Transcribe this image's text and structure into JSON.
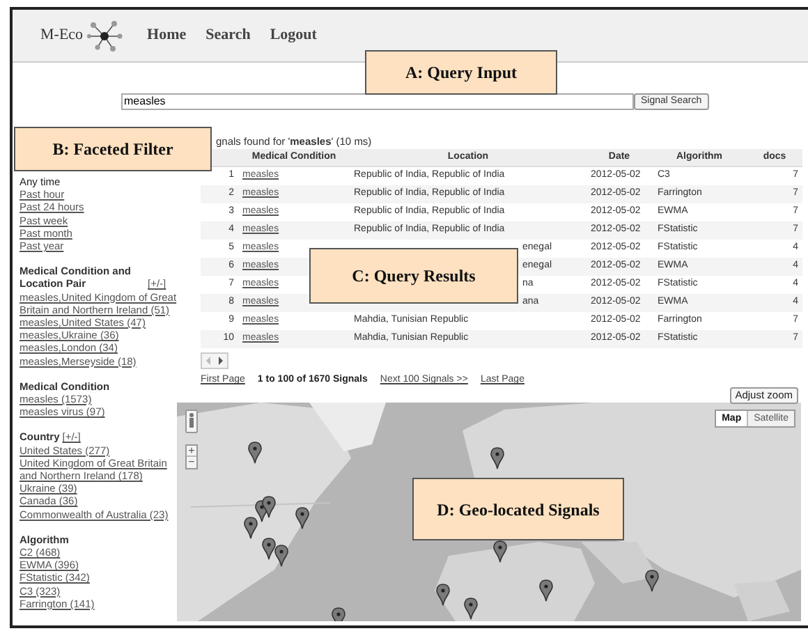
{
  "header": {
    "logo": "M-Eco",
    "nav": [
      "Home",
      "Search",
      "Logout"
    ]
  },
  "search": {
    "value": "measles",
    "button": "Signal Search"
  },
  "callouts": [
    "A: Query Input",
    "B: Faceted Filter",
    "C: Query Results",
    "D: Geo-located Signals"
  ],
  "filters": [
    {
      "items": [
        {
          "label": "Any time",
          "selected": true
        },
        {
          "label": "Past hour",
          "selected": false
        },
        {
          "label": "Past 24 hours",
          "selected": false
        },
        {
          "label": "Past week",
          "selected": false
        },
        {
          "label": "Past month",
          "selected": false
        },
        {
          "label": "Past year",
          "selected": false
        }
      ]
    },
    {
      "title": "Medical Condition and Location Pair",
      "toggle": "[+/-]",
      "items": [
        {
          "label": "measles,United Kingdom of Great Britain and Northern Ireland (51)"
        },
        {
          "label": "measles,United States (47)"
        },
        {
          "label": "measles,Ukraine (36)"
        },
        {
          "label": "measles,London (34)"
        },
        {
          "label": "measles,Merseyside (18)"
        }
      ]
    },
    {
      "title": "Medical Condition",
      "items": [
        {
          "label": "measles (1573)"
        },
        {
          "label": "measles virus (97)"
        }
      ]
    },
    {
      "title": "Country",
      "toggle": "[+/-]",
      "items": [
        {
          "label": "United States (277)"
        },
        {
          "label": "United Kingdom of Great Britain and Northern Ireland (178)"
        },
        {
          "label": "Ukraine (39)"
        },
        {
          "label": "Canada (36)"
        },
        {
          "label": "Commonwealth of Australia (23)"
        }
      ]
    },
    {
      "title": "Algorithm",
      "items": [
        {
          "label": "C2 (468)"
        },
        {
          "label": "EWMA (396)"
        },
        {
          "label": "FStatistic (342)"
        },
        {
          "label": "C3 (323)"
        },
        {
          "label": "Farrington (141)"
        }
      ]
    }
  ],
  "results": {
    "summary": "gnals found for '**measles**' (10 ms)",
    "columns": [
      "Medical Condition",
      "Location",
      "Date",
      "Algorithm",
      "docs"
    ],
    "rows": [
      {
        "number": "1",
        "condition": "measles",
        "location": "Republic of India, Republic of India",
        "partly_hidden": false,
        "date": "2012-05-02",
        "algorithm": "C3",
        "docs": "7"
      },
      {
        "number": "2",
        "condition": "measles",
        "location": "Republic of India, Republic of India",
        "partly_hidden": false,
        "date": "2012-05-02",
        "algorithm": "Farrington",
        "docs": "7"
      },
      {
        "number": "3",
        "condition": "measles",
        "location": "Republic of India, Republic of India",
        "partly_hidden": false,
        "date": "2012-05-02",
        "algorithm": "EWMA",
        "docs": "7"
      },
      {
        "number": "4",
        "condition": "measles",
        "location": "Republic of India, Republic of India",
        "partly_hidden": false,
        "date": "2012-05-02",
        "algorithm": "FStatistic",
        "docs": "7"
      },
      {
        "number": "5",
        "condition": "measles",
        "location": "enegal",
        "partly_hidden": true,
        "date": "2012-05-02",
        "algorithm": "FStatistic",
        "docs": "4"
      },
      {
        "number": "6",
        "condition": "measles",
        "location": "enegal",
        "partly_hidden": true,
        "date": "2012-05-02",
        "algorithm": "EWMA",
        "docs": "4"
      },
      {
        "number": "7",
        "condition": "measles",
        "location": "na",
        "partly_hidden": true,
        "date": "2012-05-02",
        "algorithm": "FStatistic",
        "docs": "4"
      },
      {
        "number": "8",
        "condition": "measles",
        "location": "ana",
        "partly_hidden": true,
        "date": "2012-05-02",
        "algorithm": "EWMA",
        "docs": "4"
      },
      {
        "number": "9",
        "condition": "measles",
        "location": "Mahdia, Tunisian Republic",
        "partly_hidden": false,
        "date": "2012-05-02",
        "algorithm": "Farrington",
        "docs": "7"
      },
      {
        "number": "10",
        "condition": "measles",
        "location": "Mahdia, Tunisian Republic",
        "partly_hidden": false,
        "date": "2012-05-02",
        "algorithm": "FStatistic",
        "docs": "7"
      }
    ]
  },
  "pagination": {
    "first": "First Page",
    "summary": "1 to 100 of 1670 Signals",
    "next": "Next 100 Signals >>",
    "last": "Last Page"
  },
  "map": {
    "adjust_zoom": "Adjust zoom",
    "zoom_in": "+",
    "zoom_out": "−",
    "types": [
      {
        "label": "Map",
        "selected": true
      },
      {
        "label": "Satellite",
        "selected": false
      }
    ]
  }
}
